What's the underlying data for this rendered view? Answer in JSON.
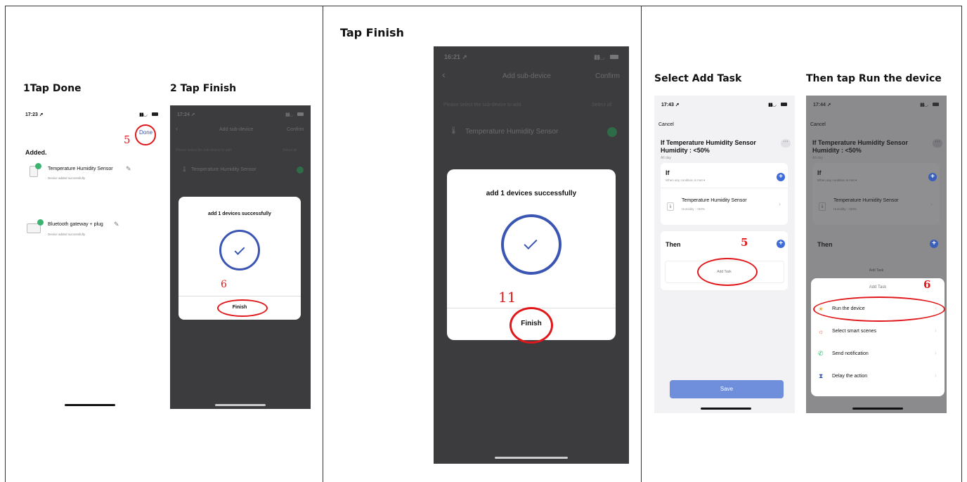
{
  "panel1": {
    "step1_title": "1Tap Done",
    "step2_title": "2 Tap Finish",
    "phone_a": {
      "time": "17:23",
      "done_label": "Done",
      "annotation": "5",
      "section_title": "Added.",
      "devices": [
        {
          "name": "Temperature Humidity Sensor",
          "status": "Device added successfully"
        },
        {
          "name": "Bluetooth gateway + plug",
          "status": "Device added successfully"
        }
      ]
    },
    "phone_b": {
      "time": "17:24",
      "nav_title": "Add sub-device",
      "confirm": "Confirm",
      "hint": "Please select the sub-device to add.",
      "select_all": "Select all",
      "device": "Temperature Humidity Sensor",
      "modal_title": "add 1 devices successfully",
      "finish": "Finish",
      "annotation": "6"
    }
  },
  "panel2": {
    "title": "Tap Finish",
    "phone": {
      "time": "16:21",
      "nav_title": "Add sub-device",
      "confirm": "Confirm",
      "hint": "Please select the sub-device to add.",
      "select_all": "Select all",
      "device": "Temperature Humidity Sensor",
      "modal_title": "add 1 devices successfully",
      "finish": "Finish",
      "annotation": "11"
    }
  },
  "panel3": {
    "step1_title": "Select Add Task",
    "step2_title": "Then tap Run the device",
    "phone_a": {
      "time": "17:43",
      "cancel": "Cancel",
      "scene_title_1": "If Temperature Humidity Sensor",
      "scene_title_2": "Humidity : <50%",
      "all_day": "All day",
      "if_label": "If",
      "if_sub": "When any condition is met",
      "cond_name": "Temperature Humidity Sensor",
      "cond_value": "Humidity : <50%",
      "then_label": "Then",
      "add_task": "Add Task",
      "save": "Save",
      "annotation": "5"
    },
    "phone_b": {
      "time": "17:44",
      "cancel": "Cancel",
      "scene_title_1": "If Temperature Humidity Sensor",
      "scene_title_2": "Humidity : <50%",
      "all_day": "All day",
      "if_label": "If",
      "if_sub": "When any condition is met",
      "cond_name": "Temperature Humidity Sensor",
      "cond_value": "Humidity : <50%",
      "then_label": "Then",
      "add_task": "Add Task",
      "sheet_title": "Add Task",
      "annotation": "6",
      "options": [
        "Run the device",
        "Select smart scenes",
        "Send notification",
        "Delay the action"
      ]
    }
  }
}
